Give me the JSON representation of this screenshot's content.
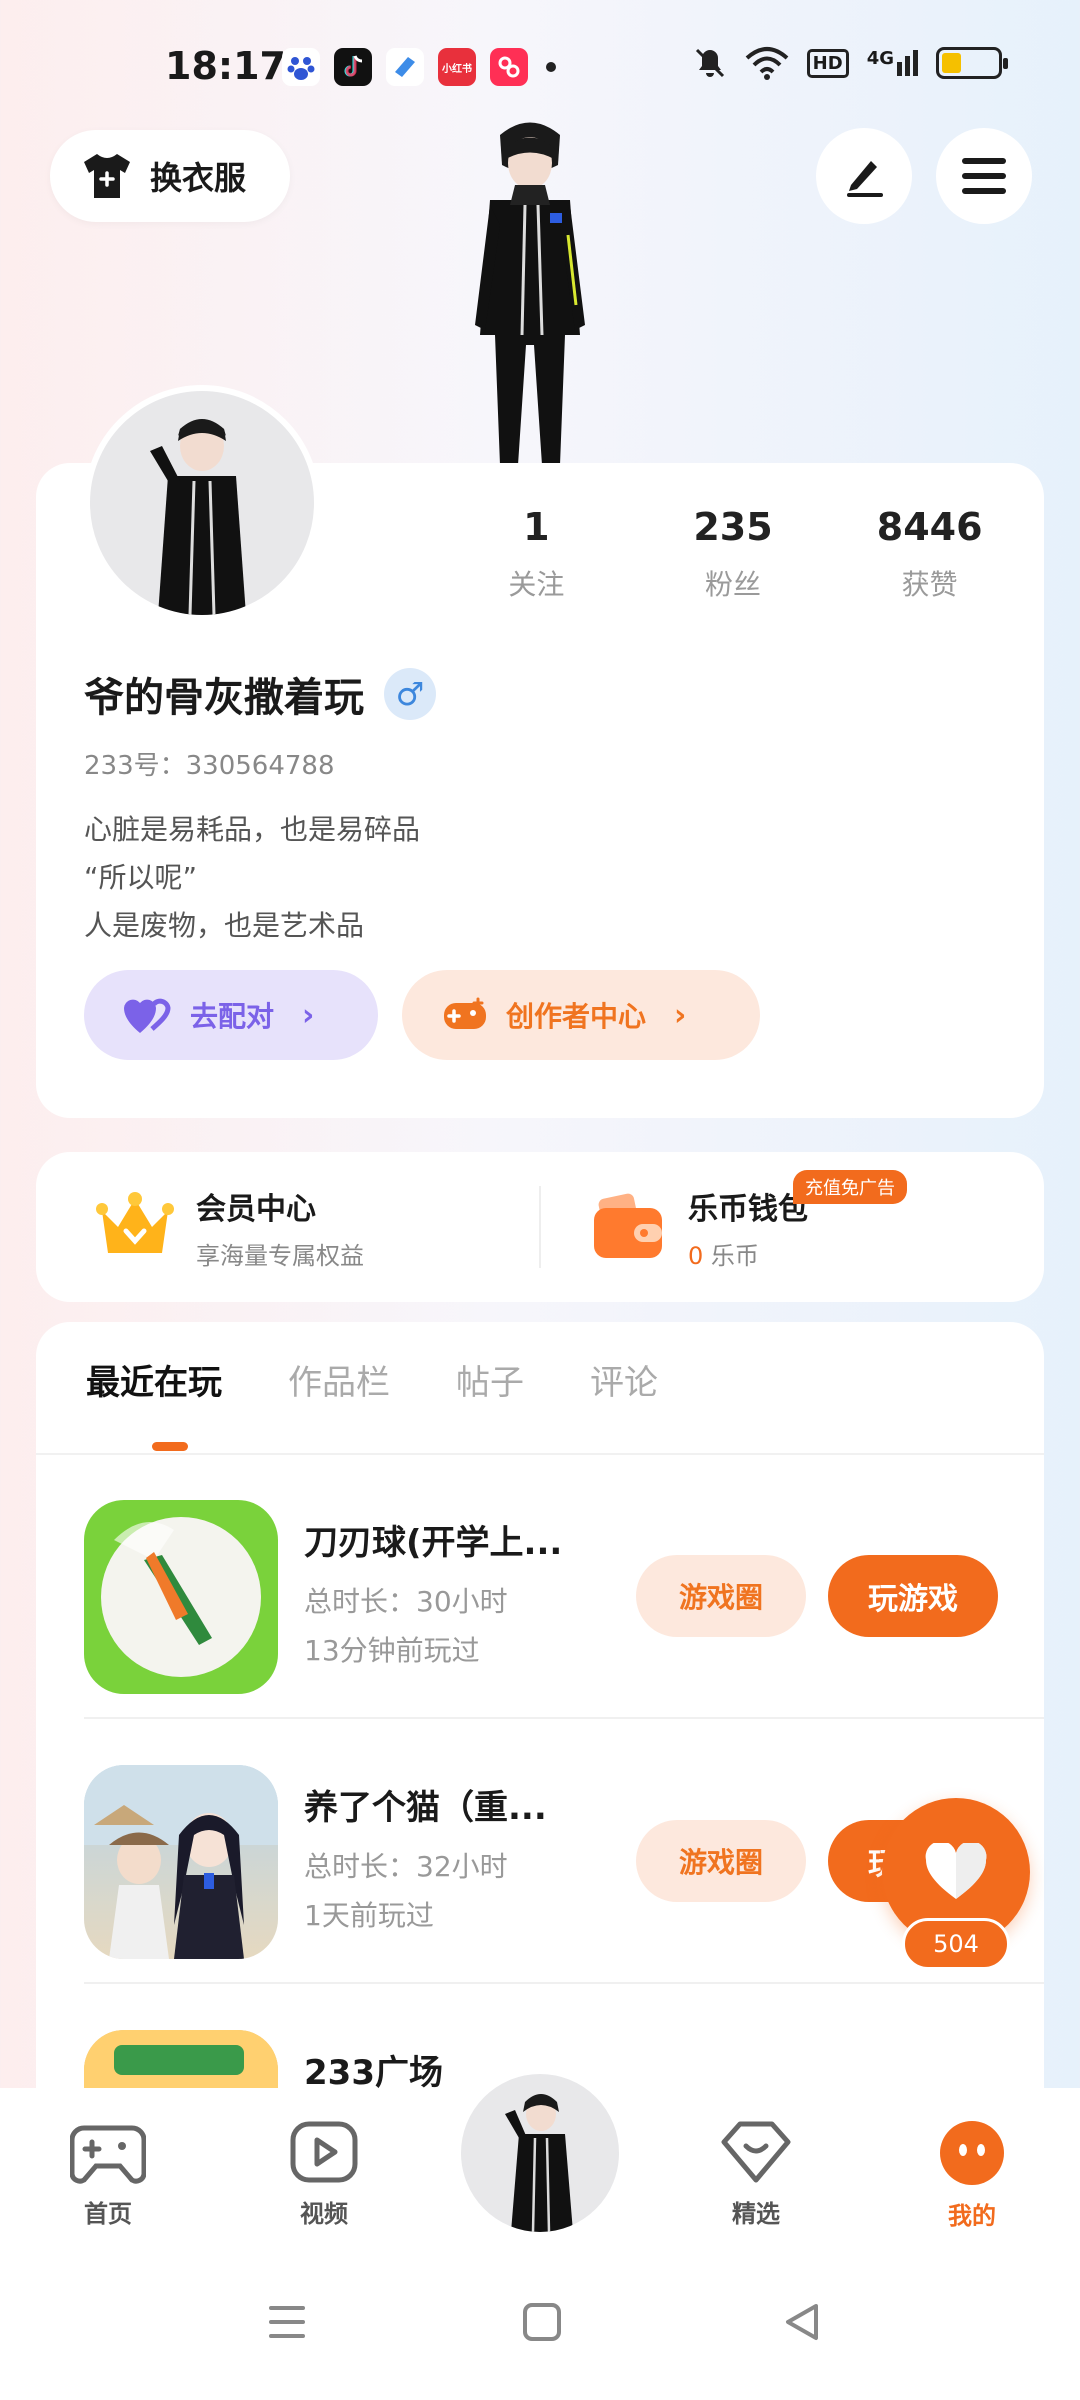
{
  "status_bar": {
    "time": "18:17",
    "app_icons": [
      "baidu-icon",
      "tiktok-icon",
      "app-icon",
      "xiaohongshu-icon",
      "app-icon"
    ],
    "right_icons": [
      "mute-icon",
      "wifi-icon",
      "hd-icon",
      "4g-signal-icon",
      "battery-icon"
    ],
    "hd_label": "HD",
    "network_label": "4G",
    "battery_level": 0.35
  },
  "top_bar": {
    "outfit_label": "换衣服",
    "edit_icon": "edit-icon",
    "menu_icon": "menu-icon"
  },
  "profile": {
    "stats": [
      {
        "value": "1",
        "label": "关注"
      },
      {
        "value": "235",
        "label": "粉丝"
      },
      {
        "value": "8446",
        "label": "获赞"
      }
    ],
    "nickname": "爷的骨灰撒着玩",
    "gender_symbol": "♂",
    "uid": "233号：330564788",
    "bio": [
      "心脏是易耗品，也是易碎品",
      "“所以呢”",
      "人是废物，也是艺术品"
    ],
    "match_label": "去配对",
    "creator_label": "创作者中心"
  },
  "vip": {
    "member_title": "会员中心",
    "member_sub": "享海量专属权益",
    "wallet_title": "乐币钱包",
    "wallet_coins": "0",
    "wallet_unit": "乐币",
    "ad_badge": "充值免广告"
  },
  "tabs": [
    {
      "label": "最近在玩",
      "active": true
    },
    {
      "label": "作品栏",
      "active": false
    },
    {
      "label": "帖子",
      "active": false
    },
    {
      "label": "评论",
      "active": false
    }
  ],
  "games": [
    {
      "name": "刀刃球(开学上...",
      "total_time": "总时长：30小时",
      "last_played": "13分钟前玩过",
      "circle_label": "游戏圈",
      "play_label": "玩游戏"
    },
    {
      "name": "养了个猫（重...",
      "total_time": "总时长：32小时",
      "last_played": "1天前玩过",
      "circle_label": "游戏圈",
      "play_label": "玩游戏"
    },
    {
      "name": "233广场",
      "total_time": "",
      "last_played": "",
      "circle_label": "",
      "play_label": ""
    }
  ],
  "floating_like": {
    "count": "504"
  },
  "bottom_nav": [
    {
      "label": "首页",
      "icon": "gamepad-icon",
      "active": false
    },
    {
      "label": "视频",
      "icon": "video-icon",
      "active": false
    },
    {
      "label": "",
      "icon": "avatar-icon",
      "active": false
    },
    {
      "label": "精选",
      "icon": "heart-diamond-icon",
      "active": false
    },
    {
      "label": "我的",
      "icon": "face-icon",
      "active": true
    }
  ],
  "colors": {
    "accent": "#f26b1d",
    "accent_light": "#fde8dd",
    "purple": "#7b62e8",
    "purple_light": "#e7e2fb"
  }
}
